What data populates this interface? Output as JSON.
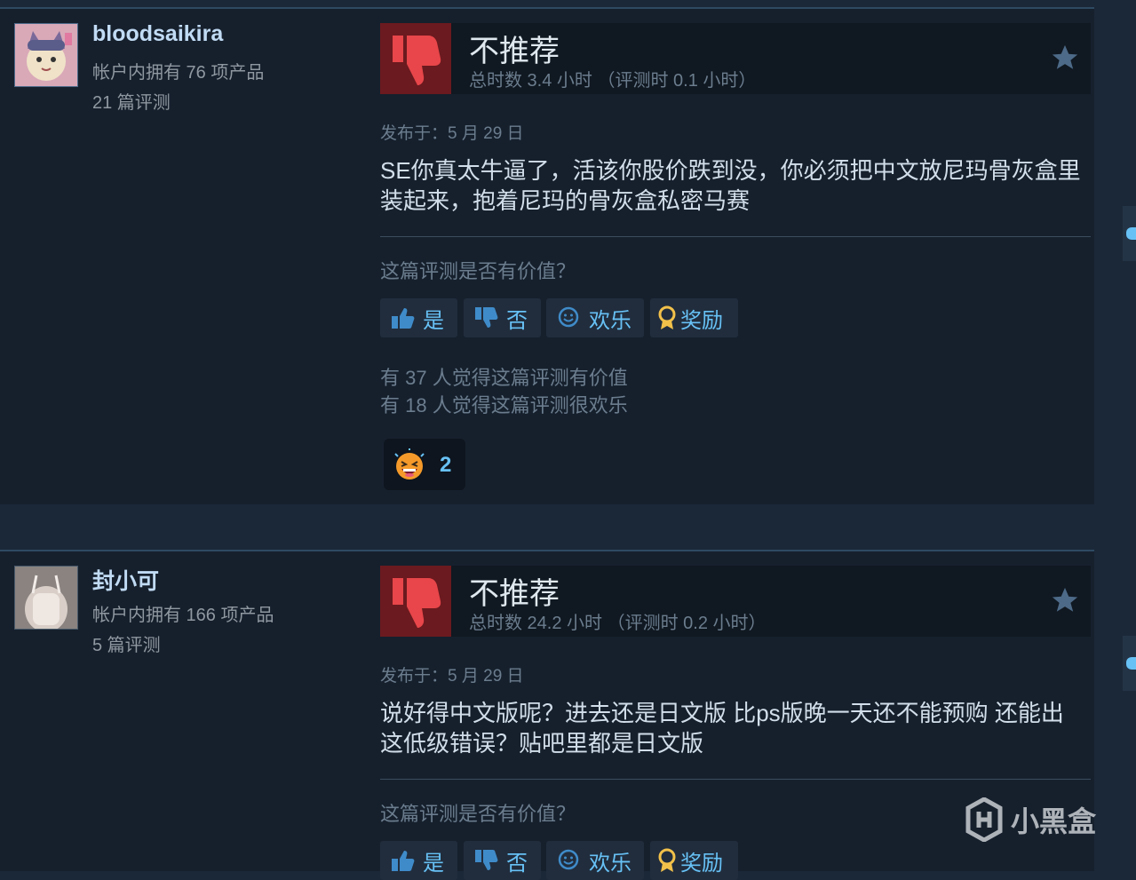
{
  "reviews": [
    {
      "username": "bloodsaikira",
      "account_products": "帐户内拥有 76 项产品",
      "review_count": "21 篇评测",
      "verdict": "不推荐",
      "hours": "总时数 3.4 小时 （评测时 0.1 小时）",
      "posted": "发布于：5 月 29 日",
      "content": "SE你真太牛逼了，活该你股价跌到没，你必须把中文放尼玛骨灰盒里装起来，抱着尼玛的骨灰盒私密马赛",
      "helpful_question": "这篇评测是否有价值？",
      "buttons": {
        "yes": "是",
        "no": "否",
        "funny": "欢乐",
        "award": "奖励"
      },
      "helpful_stat": "有 37 人觉得这篇评测有价值",
      "funny_stat": "有 18 人觉得这篇评测很欢乐",
      "reaction_count": "2"
    },
    {
      "username": "封小可",
      "account_products": "帐户内拥有 166 项产品",
      "review_count": "5 篇评测",
      "verdict": "不推荐",
      "hours": "总时数 24.2 小时 （评测时 0.2 小时）",
      "posted": "发布于：5 月 29 日",
      "content": "说好得中文版呢？进去还是日文版 比ps版晚一天还不能预购 还能出这低级错误？贴吧里都是日文版",
      "helpful_question": "这篇评测是否有价值？",
      "buttons": {
        "yes": "是",
        "no": "否",
        "funny": "欢乐",
        "award": "奖励"
      }
    }
  ],
  "watermark": "小黑盒",
  "colors": {
    "background": "#1b2838",
    "card": "#16202d",
    "thumbs_down": "#6b1a1f",
    "link_blue": "#67c1f5",
    "muted": "#6b7d8e"
  },
  "icons": [
    "thumbs-down-icon",
    "star-icon",
    "thumbs-up-icon",
    "smiley-icon",
    "award-icon",
    "laughing-emoji-icon"
  ]
}
